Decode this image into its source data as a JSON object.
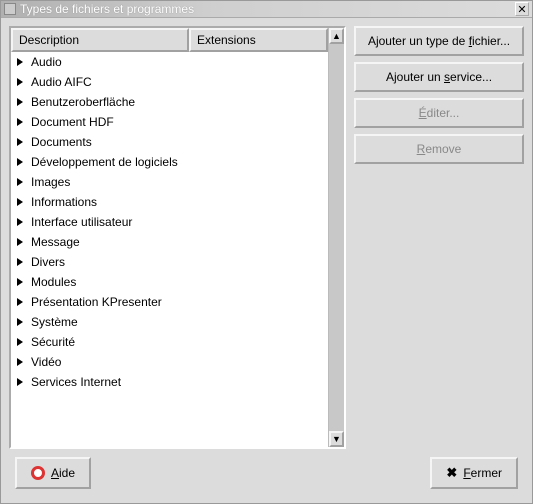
{
  "window": {
    "title": "Types de fichiers et programmes"
  },
  "list": {
    "headers": {
      "description": "Description",
      "extensions": "Extensions"
    },
    "items": [
      {
        "label": "Audio"
      },
      {
        "label": "Audio AIFC"
      },
      {
        "label": "Benutzeroberfläche"
      },
      {
        "label": "Document HDF"
      },
      {
        "label": "Documents"
      },
      {
        "label": "Développement de logiciels"
      },
      {
        "label": "Images"
      },
      {
        "label": "Informations"
      },
      {
        "label": "Interface utilisateur"
      },
      {
        "label": "Message"
      },
      {
        "label": "Divers"
      },
      {
        "label": "Modules"
      },
      {
        "label": "Présentation KPresenter"
      },
      {
        "label": "Système"
      },
      {
        "label": "Sécurité"
      },
      {
        "label": "Vidéo"
      },
      {
        "label": "Services Internet"
      }
    ]
  },
  "buttons": {
    "add_filetype": {
      "pre": "Ajouter un type de ",
      "mn": "f",
      "post": "ichier..."
    },
    "add_service": {
      "pre": "Ajouter un ",
      "mn": "s",
      "post": "ervice..."
    },
    "edit": {
      "mn": "É",
      "post": "diter..."
    },
    "remove": {
      "pre": "",
      "mn": "R",
      "post": "emove"
    }
  },
  "footer": {
    "help": {
      "mn": "A",
      "post": "ide"
    },
    "close": {
      "pre": " ",
      "mn": "F",
      "post": "ermer"
    }
  }
}
